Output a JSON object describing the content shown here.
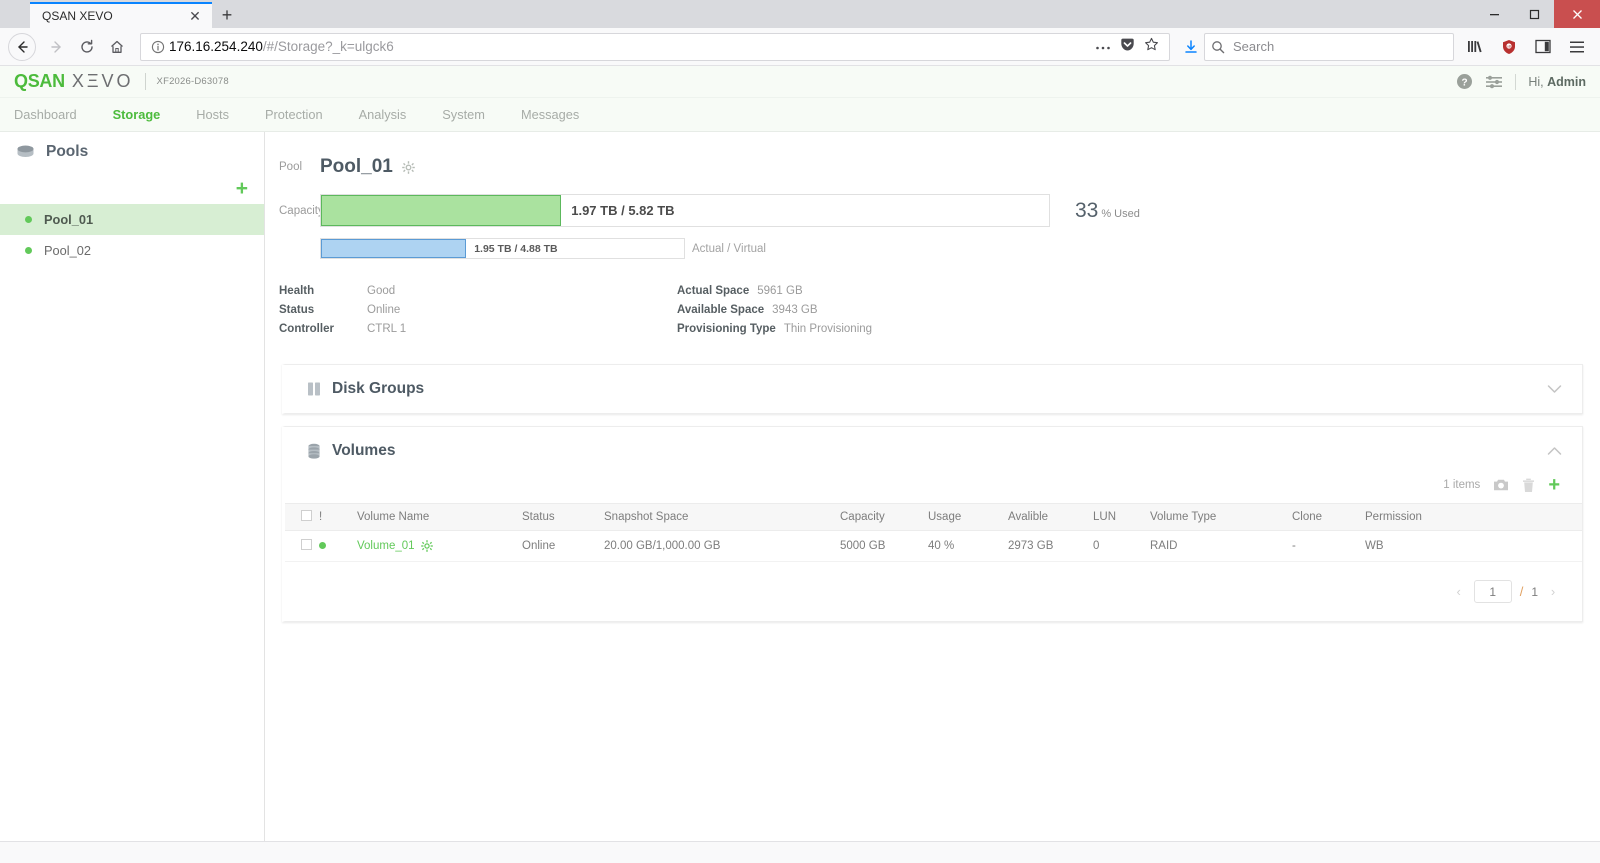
{
  "browser": {
    "tab_title": "QSAN XEVO",
    "tab_close_glyph": "✕",
    "newtab_glyph": "+",
    "url": "176.16.254.240",
    "url_path": "/#/Storage?_k=ulgck6",
    "search_placeholder": "Search",
    "search_value": "",
    "window_minimize": "—",
    "window_maximize": "□",
    "window_close": "✕"
  },
  "app": {
    "logo_primary": "QSAN",
    "logo_secondary": "XΞVO",
    "model": "XF2026-D63078",
    "user_greeting": "Hi,",
    "user_name": "Admin",
    "nav_tabs": [
      {
        "label": "Dashboard",
        "active": false
      },
      {
        "label": "Storage",
        "active": true
      },
      {
        "label": "Hosts",
        "active": false
      },
      {
        "label": "Protection",
        "active": false
      },
      {
        "label": "Analysis",
        "active": false
      },
      {
        "label": "System",
        "active": false
      },
      {
        "label": "Messages",
        "active": false
      }
    ]
  },
  "sidebar": {
    "title": "Pools",
    "add_glyph": "+",
    "items": [
      {
        "label": "Pool_01",
        "active": true
      },
      {
        "label": "Pool_02",
        "active": false
      }
    ]
  },
  "pool": {
    "pool_label": "Pool",
    "name": "Pool_01",
    "capacity_label": "Capacity",
    "capacity_used_text": "1.97 TB / 5.82 TB",
    "capacity_percent_value": "33",
    "capacity_percent_symbol": "%",
    "capacity_percent_word": "Used",
    "capacity_fill_percent": 33,
    "virtual_used_text": "1.95 TB / 4.88 TB",
    "virtual_fill_percent": 40,
    "virtual_label": "Actual / Virtual",
    "details_left": [
      {
        "key": "Health",
        "value": "Good"
      },
      {
        "key": "Status",
        "value": "Online"
      },
      {
        "key": "Controller",
        "value": "CTRL 1"
      }
    ],
    "details_right": [
      {
        "key": "Actual Space",
        "value": "5961 GB"
      },
      {
        "key": "Available Space",
        "value": "3943 GB"
      },
      {
        "key": "Provisioning Type",
        "value": "Thin Provisioning"
      }
    ]
  },
  "panels": {
    "disk_groups_title": "Disk Groups",
    "volumes_title": "Volumes"
  },
  "volumes": {
    "items_count": "1 items",
    "add_glyph": "+",
    "headers": [
      "",
      "!",
      "Volume Name",
      "Status",
      "Snapshot Space",
      "Capacity",
      "Usage",
      "Avalible",
      "LUN",
      "Volume Type",
      "Clone",
      "Permission"
    ],
    "rows": [
      {
        "name": "Volume_01",
        "status": "Online",
        "snapshot_space": "20.00 GB/1,000.00 GB",
        "capacity": "5000 GB",
        "usage": "40 %",
        "available": "2973 GB",
        "lun": "0",
        "volume_type": "RAID",
        "clone": "-",
        "permission": "WB"
      }
    ],
    "pager": {
      "prev": "‹",
      "current": "1",
      "separator": "/",
      "total": "1",
      "next": "›"
    }
  },
  "colors": {
    "brand_green": "#4cbb3c",
    "accent_green": "#62c95a",
    "capacity_bar_fill": "#aae29f",
    "capacity_bar_border": "#5cb85c",
    "virtual_bar_fill": "#aed3f2",
    "virtual_bar_border": "#5b9bd5",
    "heading_slate": "#4e5a64",
    "close_button_red": "#c94f4f"
  }
}
